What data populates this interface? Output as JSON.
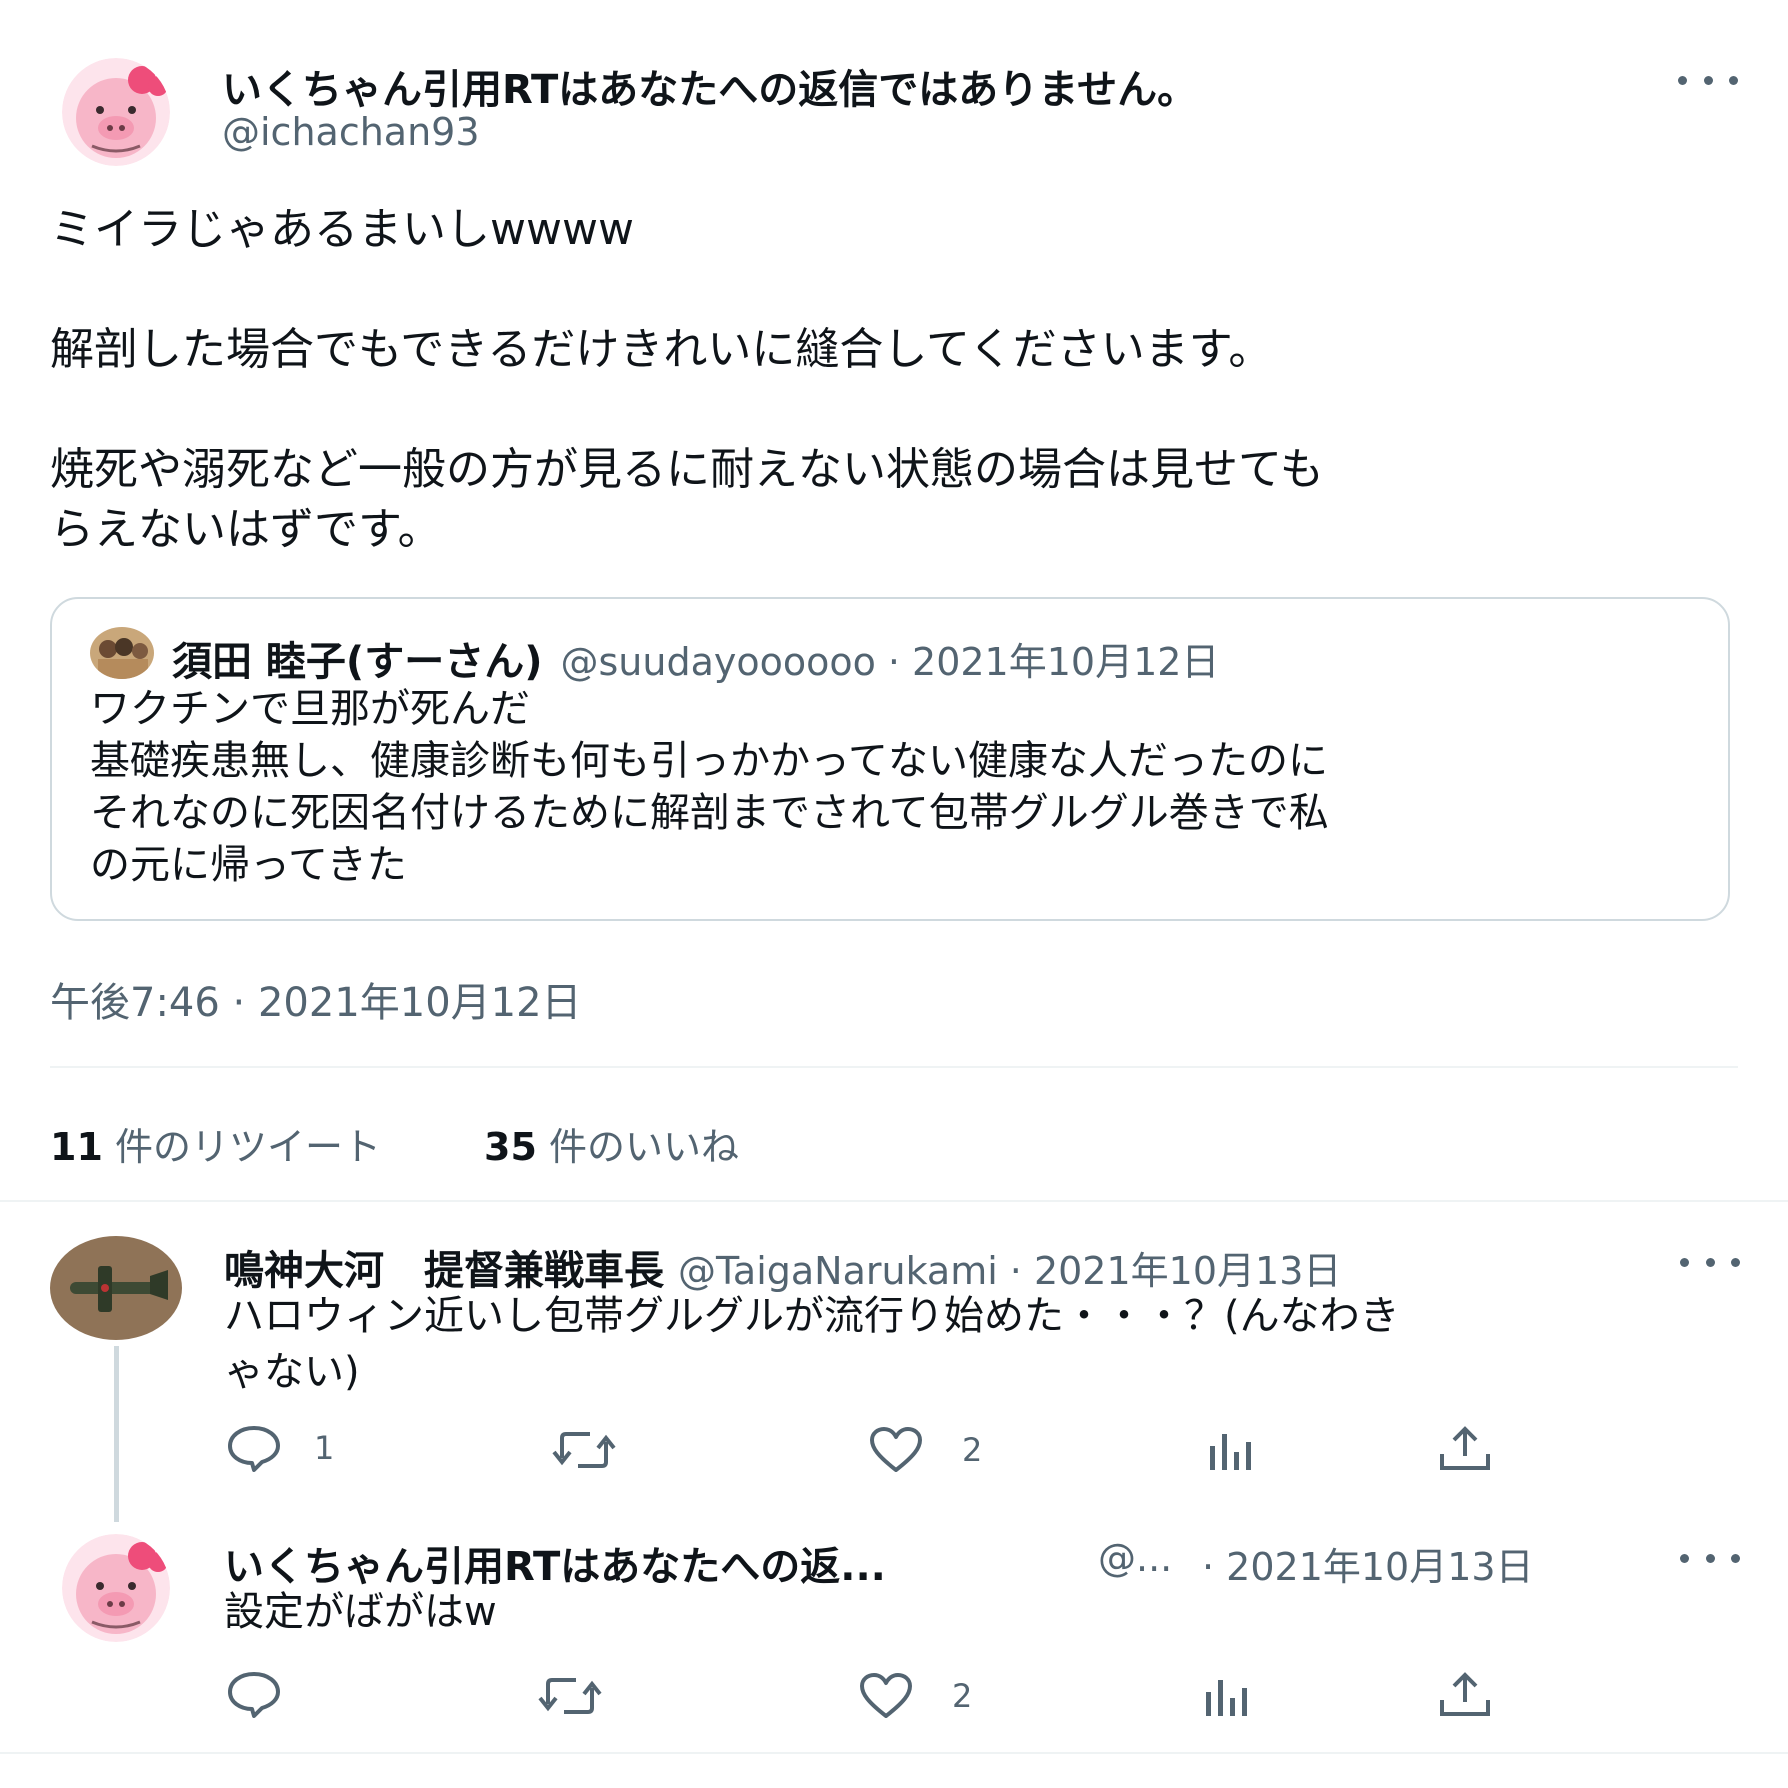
{
  "main_tweet": {
    "author_name": "いくちゃん引用RTはあなたへの返信ではありません。",
    "author_handle": "@ichachan93",
    "text": "ミイラじゃあるまいしwwww\n\n解剖した場合でもできるだけきれいに縫合してくださいます。\n\n焼死や溺死など一般の方が見るに耐えない状態の場合は見せても\nらえないはずです。",
    "quote": {
      "author_name": "須田 睦子(すーさん)",
      "author_handle": "@suudayoooooo",
      "date": "· 2021年10月12日",
      "text": "ワクチンで旦那が死んだ\n基礎疾患無し、健康診断も何も引っかかってない健康な人だったのに\nそれなのに死因名付けるために解剖までされて包帯グルグル巻きで私\nの元に帰ってきた"
    },
    "timestamp": "午後7:46 · 2021年10月12日",
    "retweets_count": "11",
    "retweets_label": "件のリツイート",
    "likes_count": "35",
    "likes_label": "件のいいね"
  },
  "replies": [
    {
      "author_name": "鳴神大河　提督兼戦車長",
      "author_handle": "@TaigaNarukami",
      "date": "· 2021年10月13日",
      "text": "ハロウィン近いし包帯グルグルが流行り始めた・・・？(んなわき\nゃない)",
      "reply_count": "1",
      "retweet_count": "",
      "like_count": "2"
    },
    {
      "author_name": "いくちゃん引用RTはあなたへの返...",
      "author_handle": "@...",
      "date": "· 2021年10月13日",
      "text": "設定がばがはw",
      "reply_count": "",
      "retweet_count": "",
      "like_count": "2"
    }
  ],
  "colors": {
    "text_primary": "#0f1419",
    "text_secondary": "#536471",
    "border": "#cfd9de",
    "divider": "#eff3f4",
    "avatar_pink": "#f7b6c8"
  }
}
